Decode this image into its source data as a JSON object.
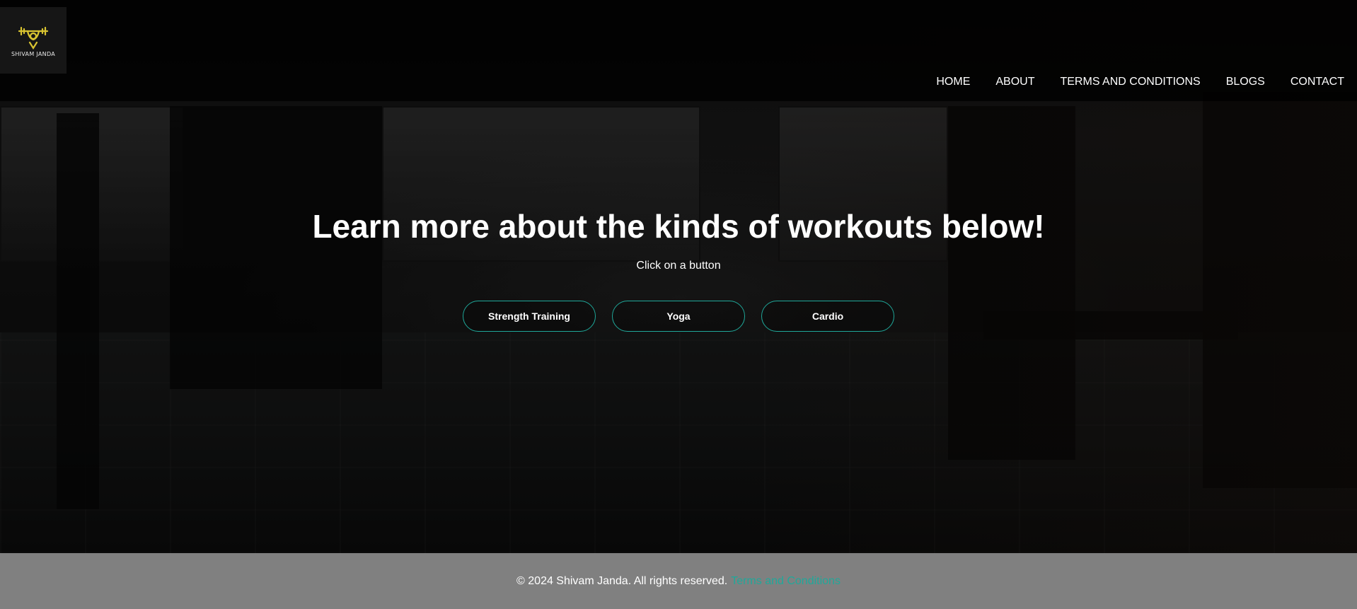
{
  "brand": {
    "name": "SHIVAM JANDA",
    "accent": "#d9c431"
  },
  "nav": {
    "items": [
      {
        "label": "HOME"
      },
      {
        "label": "ABOUT"
      },
      {
        "label": "TERMS AND CONDITIONS"
      },
      {
        "label": "BLOGS"
      },
      {
        "label": "CONTACT"
      }
    ]
  },
  "hero": {
    "title": "Learn more about the kinds of workouts below!",
    "subtitle": "Click on a button",
    "buttons": [
      {
        "label": "Strength Training"
      },
      {
        "label": "Yoga"
      },
      {
        "label": "Cardio"
      }
    ],
    "button_border_color": "#1fa89a"
  },
  "footer": {
    "copyright": "© 2024 Shivam Janda. All rights reserved.",
    "link_label": "Terms and Conditions",
    "background": "#808080",
    "link_color": "#1fa89a"
  }
}
